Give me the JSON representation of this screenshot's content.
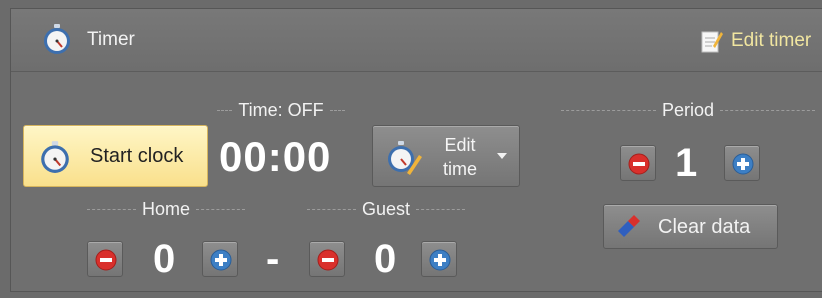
{
  "header": {
    "title": "Timer",
    "edit_timer_label": "Edit timer"
  },
  "timer": {
    "label": "Time: OFF",
    "start_label": "Start clock",
    "value": "00:00",
    "edit_label_line1": "Edit",
    "edit_label_line2": "time"
  },
  "period": {
    "label": "Period",
    "value": "1",
    "clear_label": "Clear data"
  },
  "score": {
    "home_label": "Home",
    "home_value": "0",
    "separator": "-",
    "guest_label": "Guest",
    "guest_value": "0"
  },
  "colors": {
    "background": "#6f6f6f",
    "start_button": "#fbe8a0",
    "minus_icon": "#d9302c",
    "plus_icon": "#3d7fc4",
    "edit_timer_text": "#f1e6a0"
  },
  "icons": {
    "header": "stopwatch-icon",
    "edit_timer": "notepad-pencil-icon",
    "start": "stopwatch-icon",
    "edit_time": "stopwatch-pencil-icon",
    "minus": "minus-circle-icon",
    "plus": "plus-circle-icon",
    "clear": "eraser-icon"
  }
}
